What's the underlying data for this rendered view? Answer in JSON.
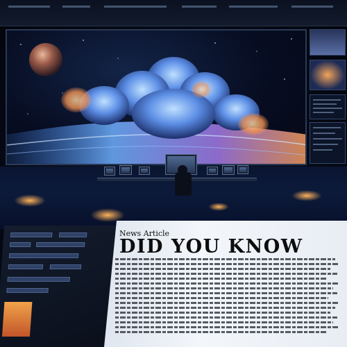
{
  "article": {
    "label": "News Article",
    "headline": "DID YOU KNOW"
  },
  "scene": {
    "main_display": "cosmic-cloud-visual",
    "planet": "planet-icon",
    "accent": "#f0a24a",
    "screen_blue": "#3f7fe0"
  }
}
